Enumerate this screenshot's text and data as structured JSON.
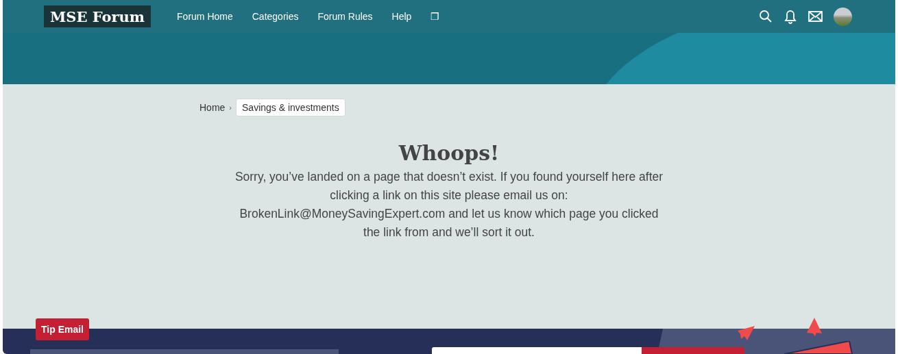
{
  "header": {
    "logo": "MSE Forum",
    "nav": [
      {
        "label": "Forum Home"
      },
      {
        "label": "Categories"
      },
      {
        "label": "Forum Rules"
      },
      {
        "label": "Help"
      },
      {
        "label": "❐"
      }
    ]
  },
  "breadcrumb": [
    {
      "label": "Home",
      "kind": "link"
    },
    {
      "label": "›",
      "kind": "separator"
    },
    {
      "label": "Savings & investments",
      "kind": "current"
    }
  ],
  "error": {
    "title": "Whoops!",
    "message_before": "Sorry, you’ve landed on a page that doesn’t exist. If you found yourself here after clicking a link on this site please email us on: ",
    "email": "BrokenLink@MoneySavingExpert.com",
    "message_after": " and let us know which page you clicked the link from and we’ll sort it out."
  },
  "footer": {
    "badge": "Tip Email"
  }
}
